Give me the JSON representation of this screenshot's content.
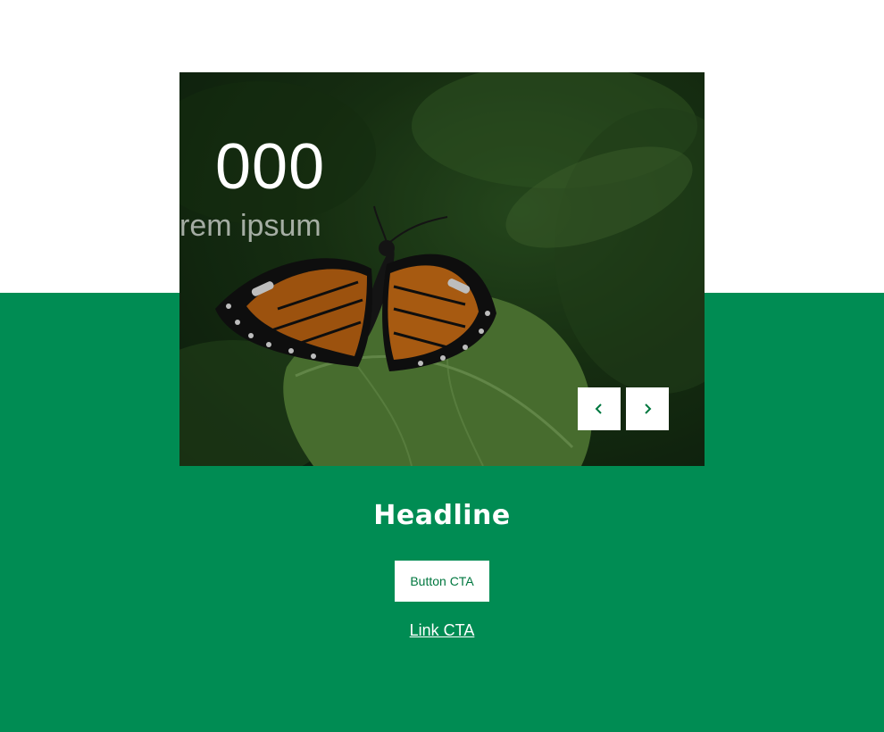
{
  "hero": {
    "stat_number": "000",
    "stat_label": "rem ipsum",
    "image_subject": "monarch butterfly on leaf",
    "prev_button": {
      "icon": "chevron-left-icon"
    },
    "next_button": {
      "icon": "chevron-right-icon"
    }
  },
  "content": {
    "headline": "Headline",
    "button_cta": "Button CTA",
    "link_cta": "Link CTA"
  },
  "colors": {
    "brand_green": "#008c53",
    "background": "#ffffff",
    "text_light": "#ffffff",
    "button_text": "#00773f"
  }
}
